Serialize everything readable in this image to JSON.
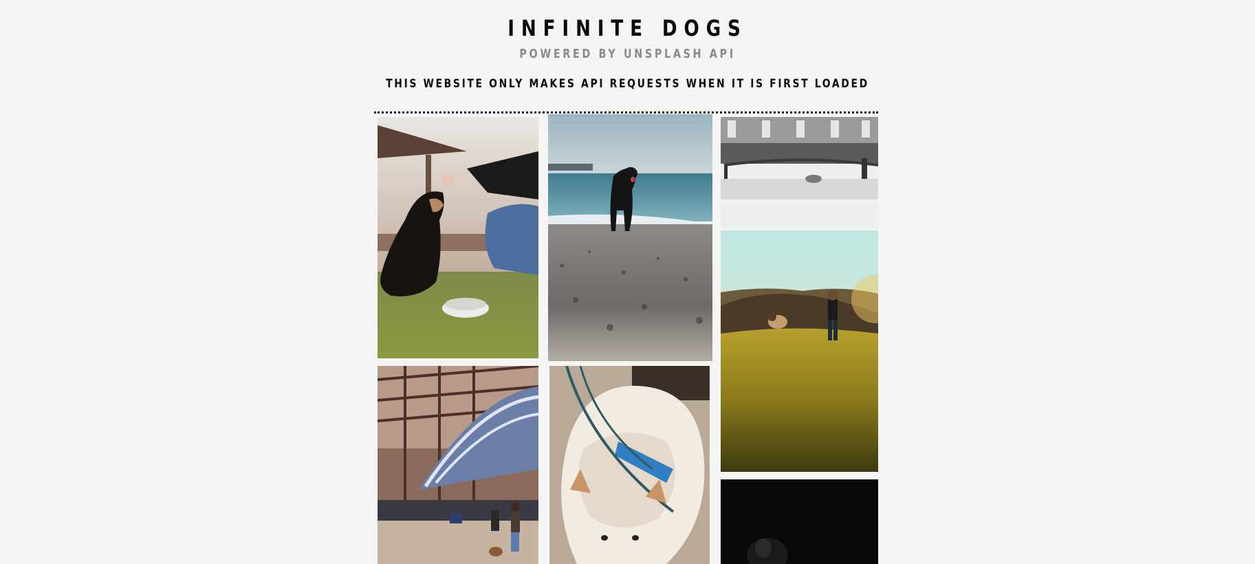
{
  "header": {
    "title": "INFINITE DOGS",
    "subtitle": "POWERED BY UNSPLASH API",
    "notice": "THIS WEBSITE ONLY MAKES API REQUESTS WHEN IT IS FIRST LOADED"
  },
  "colors": {
    "background": "#f4f4f4",
    "title": "#0a0a0a",
    "subtitle": "#8a8a8a",
    "divider": "#111111"
  }
}
